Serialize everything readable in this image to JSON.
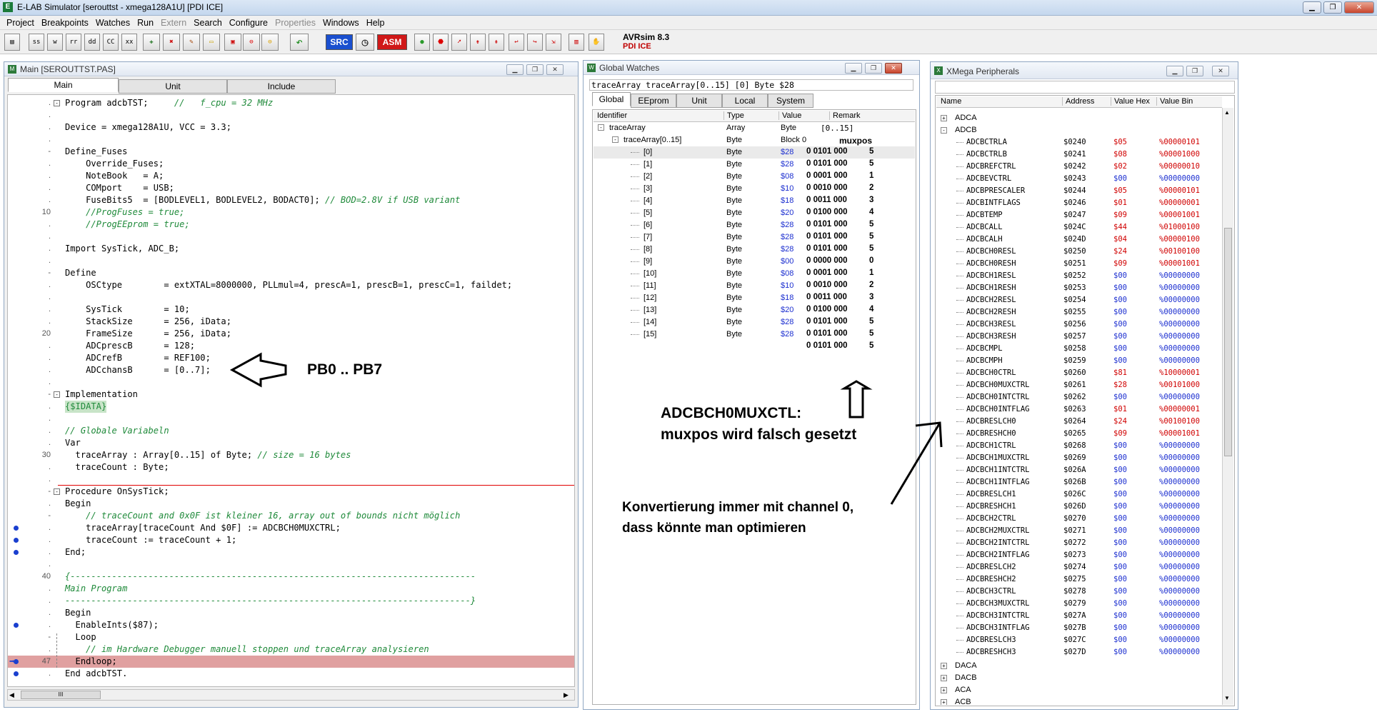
{
  "app": {
    "title": "E-LAB Simulator [serouttst - xmega128A1U] [PDI ICE]",
    "icon": "elab-app-icon"
  },
  "menu": [
    "Project",
    "Breakpoints",
    "Watches",
    "Run",
    "Extern",
    "Search",
    "Configure",
    "Properties",
    "Windows",
    "Help"
  ],
  "menu_disabled": [
    "Extern",
    "Properties"
  ],
  "toolbar": {
    "buttons": [
      "ss",
      "w",
      "rr",
      "dd",
      "CC",
      "xx"
    ],
    "src": "SRC",
    "asm": "ASM",
    "version": "AVRsim 8.3",
    "mode": "PDI ICE"
  },
  "main_window": {
    "title": "Main [SEROUTTST.PAS]",
    "tabs": [
      "Main",
      "Unit",
      "Include"
    ]
  },
  "code_lines": [
    {
      "g": ".",
      "t": "Program adcbTST;     //   f_cpu = 32 MHz",
      "f": "-"
    },
    {
      "g": ".",
      "t": ""
    },
    {
      "g": ".",
      "t": "Device = xmega128A1U, VCC = 3.3;"
    },
    {
      "g": ".",
      "t": ""
    },
    {
      "g": "-",
      "t": "Define_Fuses"
    },
    {
      "g": ".",
      "t": "    Override_Fuses;"
    },
    {
      "g": ".",
      "t": "    NoteBook   = A;"
    },
    {
      "g": ".",
      "t": "    COMport    = USB;"
    },
    {
      "g": ".",
      "t": "    FuseBits5  = [BODLEVEL1, BODLEVEL2, BODACT0]; // BOD=2.8V if USB variant"
    },
    {
      "g": "10",
      "t": "    //ProgFuses = true;"
    },
    {
      "g": ".",
      "t": "    //ProgEEprom = true;"
    },
    {
      "g": ".",
      "t": ""
    },
    {
      "g": ".",
      "t": "Import SysTick, ADC_B;"
    },
    {
      "g": ".",
      "t": ""
    },
    {
      "g": "-",
      "t": "Define"
    },
    {
      "g": ".",
      "t": "    OSCtype        = extXTAL=8000000, PLLmul=4, prescA=1, prescB=1, prescC=1, faildet;"
    },
    {
      "g": ".",
      "t": ""
    },
    {
      "g": ".",
      "t": "    SysTick        = 10;"
    },
    {
      "g": ".",
      "t": "    StackSize      = 256, iData;"
    },
    {
      "g": "20",
      "t": "    FrameSize      = 256, iData;"
    },
    {
      "g": ".",
      "t": "    ADCprescB      = 128;"
    },
    {
      "g": ".",
      "t": "    ADCrefB        = REF100;"
    },
    {
      "g": ".",
      "t": "    ADCchansB      = [0..7];"
    },
    {
      "g": ".",
      "t": ""
    },
    {
      "g": "-",
      "t": "Implementation",
      "f": "-"
    },
    {
      "g": ".",
      "t": "{$IDATA}"
    },
    {
      "g": ".",
      "t": ""
    },
    {
      "g": ".",
      "t": "// Globale Variabeln"
    },
    {
      "g": ".",
      "t": "Var"
    },
    {
      "g": "30",
      "t": "  traceArray : Array[0..15] of Byte; // size = 16 bytes"
    },
    {
      "g": ".",
      "t": "  traceCount : Byte;"
    },
    {
      "g": ".",
      "t": ""
    },
    {
      "g": "-",
      "t": "Procedure OnSysTick;",
      "f": "-"
    },
    {
      "g": ".",
      "t": "Begin"
    },
    {
      "g": "-",
      "t": "    // traceCount and 0x0F ist kleiner 16, array out of bounds nicht möglich"
    },
    {
      "g": ".",
      "t": "    traceArray[traceCount And $0F] := ADCBCH0MUXCTRL;",
      "bp": true
    },
    {
      "g": ".",
      "t": "    traceCount := traceCount + 1;",
      "bp": true
    },
    {
      "g": ".",
      "t": "End;",
      "bp": true
    },
    {
      "g": ".",
      "t": ""
    },
    {
      "g": "40",
      "t": "{------------------------------------------------------------------------------"
    },
    {
      "g": ".",
      "t": "Main Program"
    },
    {
      "g": ".",
      "t": "------------------------------------------------------------------------------}"
    },
    {
      "g": ".",
      "t": "Begin"
    },
    {
      "g": ".",
      "t": "  EnableInts($87);",
      "bp": true
    },
    {
      "g": "-",
      "t": "  Loop"
    },
    {
      "g": ".",
      "t": "    // im Hardware Debugger manuell stoppen und traceArray analysieren"
    },
    {
      "g": "47",
      "t": "  Endloop;",
      "bp": true,
      "cur": true
    },
    {
      "g": ".",
      "t": "End adcbTST.",
      "bp": true
    }
  ],
  "watches": {
    "title": "Global Watches",
    "status": "traceArray traceArray[0..15] [0] Byte $28",
    "tabs": [
      "Global",
      "EEprom",
      "Unit",
      "Local",
      "System"
    ],
    "headers": [
      "Identifier",
      "Type",
      "Value",
      "Remark"
    ],
    "root": {
      "name": "traceArray",
      "type": "Array",
      "value": "Byte",
      "remark": "[0..15]"
    },
    "sub": {
      "name": "traceArray[0..15]",
      "type": "Byte",
      "value": "Block 0"
    },
    "items": [
      {
        "i": "[0]",
        "v": "$28"
      },
      {
        "i": "[1]",
        "v": "$28"
      },
      {
        "i": "[2]",
        "v": "$08"
      },
      {
        "i": "[3]",
        "v": "$10"
      },
      {
        "i": "[4]",
        "v": "$18"
      },
      {
        "i": "[5]",
        "v": "$20"
      },
      {
        "i": "[6]",
        "v": "$28"
      },
      {
        "i": "[7]",
        "v": "$28"
      },
      {
        "i": "[8]",
        "v": "$28"
      },
      {
        "i": "[9]",
        "v": "$00"
      },
      {
        "i": "[10]",
        "v": "$08"
      },
      {
        "i": "[11]",
        "v": "$10"
      },
      {
        "i": "[12]",
        "v": "$18"
      },
      {
        "i": "[13]",
        "v": "$20"
      },
      {
        "i": "[14]",
        "v": "$28"
      },
      {
        "i": "[15]",
        "v": "$28"
      }
    ],
    "type": "Byte",
    "muxpos_header": "muxpos",
    "muxpos_bits": [
      "0 0101 000",
      "0 0101 000",
      "0 0001 000",
      "0 0010 000",
      "0 0011 000",
      "0 0100 000",
      "0 0101 000",
      "0 0101 000",
      "0 0101 000",
      "0 0000 000",
      "0 0001 000",
      "0 0010 000",
      "0 0011 000",
      "0 0100 000",
      "0 0101 000",
      "0 0101 000"
    ],
    "muxpos_vals": [
      "5",
      "5",
      "1",
      "2",
      "3",
      "4",
      "5",
      "5",
      "5",
      "0",
      "1",
      "2",
      "3",
      "4",
      "5",
      "5"
    ]
  },
  "peripherals": {
    "title": "XMega Peripherals",
    "headers": [
      "Name",
      "Address",
      "Value Hex",
      "Value Bin"
    ],
    "top_groups": [
      "ADCA",
      "ADCB"
    ],
    "regs": [
      [
        "ADCBCTRLA",
        "$0240",
        "$05",
        "%00000101"
      ],
      [
        "ADCBCTRLB",
        "$0241",
        "$08",
        "%00001000"
      ],
      [
        "ADCBREFCTRL",
        "$0242",
        "$02",
        "%00000010"
      ],
      [
        "ADCBEVCTRL",
        "$0243",
        "$00",
        "%00000000"
      ],
      [
        "ADCBPRESCALER",
        "$0244",
        "$05",
        "%00000101"
      ],
      [
        "ADCBINTFLAGS",
        "$0246",
        "$01",
        "%00000001"
      ],
      [
        "ADCBTEMP",
        "$0247",
        "$09",
        "%00001001"
      ],
      [
        "ADCBCALL",
        "$024C",
        "$44",
        "%01000100"
      ],
      [
        "ADCBCALH",
        "$024D",
        "$04",
        "%00000100"
      ],
      [
        "ADCBCH0RESL",
        "$0250",
        "$24",
        "%00100100"
      ],
      [
        "ADCBCH0RESH",
        "$0251",
        "$09",
        "%00001001"
      ],
      [
        "ADCBCH1RESL",
        "$0252",
        "$00",
        "%00000000"
      ],
      [
        "ADCBCH1RESH",
        "$0253",
        "$00",
        "%00000000"
      ],
      [
        "ADCBCH2RESL",
        "$0254",
        "$00",
        "%00000000"
      ],
      [
        "ADCBCH2RESH",
        "$0255",
        "$00",
        "%00000000"
      ],
      [
        "ADCBCH3RESL",
        "$0256",
        "$00",
        "%00000000"
      ],
      [
        "ADCBCH3RESH",
        "$0257",
        "$00",
        "%00000000"
      ],
      [
        "ADCBCMPL",
        "$0258",
        "$00",
        "%00000000"
      ],
      [
        "ADCBCMPH",
        "$0259",
        "$00",
        "%00000000"
      ],
      [
        "ADCBCH0CTRL",
        "$0260",
        "$81",
        "%10000001"
      ],
      [
        "ADCBCH0MUXCTRL",
        "$0261",
        "$28",
        "%00101000"
      ],
      [
        "ADCBCH0INTCTRL",
        "$0262",
        "$00",
        "%00000000"
      ],
      [
        "ADCBCH0INTFLAG",
        "$0263",
        "$01",
        "%00000001"
      ],
      [
        "ADCBRESLCH0",
        "$0264",
        "$24",
        "%00100100"
      ],
      [
        "ADCBRESHCH0",
        "$0265",
        "$09",
        "%00001001"
      ],
      [
        "ADCBCH1CTRL",
        "$0268",
        "$00",
        "%00000000"
      ],
      [
        "ADCBCH1MUXCTRL",
        "$0269",
        "$00",
        "%00000000"
      ],
      [
        "ADCBCH1INTCTRL",
        "$026A",
        "$00",
        "%00000000"
      ],
      [
        "ADCBCH1INTFLAG",
        "$026B",
        "$00",
        "%00000000"
      ],
      [
        "ADCBRESLCH1",
        "$026C",
        "$00",
        "%00000000"
      ],
      [
        "ADCBRESHCH1",
        "$026D",
        "$00",
        "%00000000"
      ],
      [
        "ADCBCH2CTRL",
        "$0270",
        "$00",
        "%00000000"
      ],
      [
        "ADCBCH2MUXCTRL",
        "$0271",
        "$00",
        "%00000000"
      ],
      [
        "ADCBCH2INTCTRL",
        "$0272",
        "$00",
        "%00000000"
      ],
      [
        "ADCBCH2INTFLAG",
        "$0273",
        "$00",
        "%00000000"
      ],
      [
        "ADCBRESLCH2",
        "$0274",
        "$00",
        "%00000000"
      ],
      [
        "ADCBRESHCH2",
        "$0275",
        "$00",
        "%00000000"
      ],
      [
        "ADCBCH3CTRL",
        "$0278",
        "$00",
        "%00000000"
      ],
      [
        "ADCBCH3MUXCTRL",
        "$0279",
        "$00",
        "%00000000"
      ],
      [
        "ADCBCH3INTCTRL",
        "$027A",
        "$00",
        "%00000000"
      ],
      [
        "ADCBCH3INTFLAG",
        "$027B",
        "$00",
        "%00000000"
      ],
      [
        "ADCBRESLCH3",
        "$027C",
        "$00",
        "%00000000"
      ],
      [
        "ADCBRESHCH3",
        "$027D",
        "$00",
        "%00000000"
      ]
    ],
    "bottom_groups": [
      "DACA",
      "DACB",
      "ACA",
      "ACB"
    ]
  },
  "annotations": {
    "pb": "PB0 .. PB7",
    "mux1": "ADCBCH0MUXCTL:",
    "mux2": "muxpos wird falsch gesetzt",
    "conv1": "Konvertierung immer mit channel 0,",
    "conv2": "dass könnte man optimieren"
  },
  "scrollbar_label": "III"
}
